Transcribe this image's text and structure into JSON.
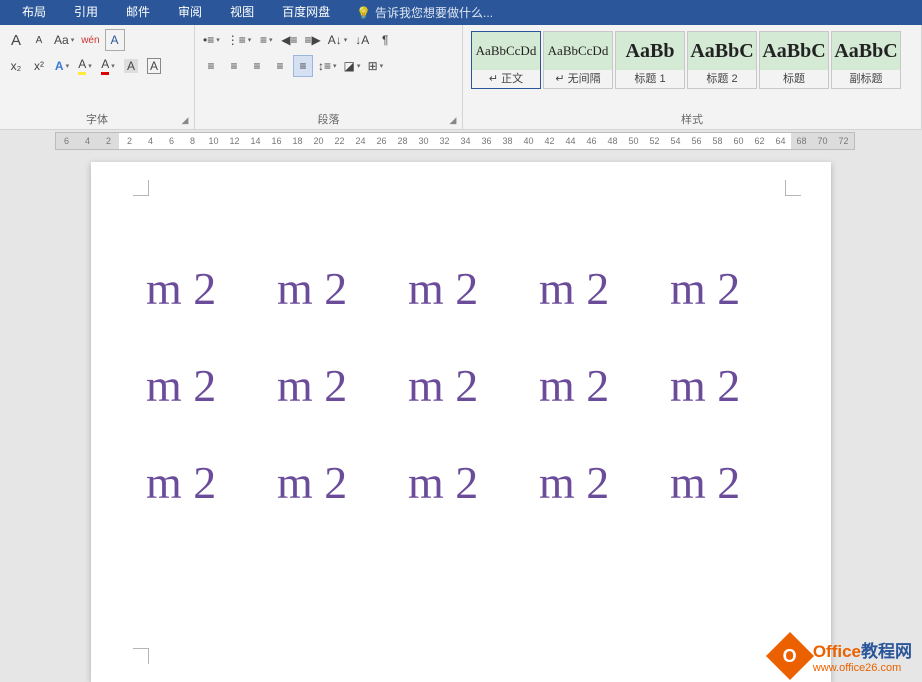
{
  "menubar": {
    "tabs": [
      "布局",
      "引用",
      "邮件",
      "审阅",
      "视图",
      "百度网盘"
    ],
    "tell_me": "告诉我您想要做什么..."
  },
  "ribbon": {
    "font": {
      "label": "字体",
      "grow": "A",
      "shrink": "A",
      "case": "Aa",
      "phonetic": "wén",
      "clear": "A",
      "sub": "x₂",
      "sup": "x²",
      "text_effect": "A",
      "highlight": "A",
      "font_color": "A",
      "char_shading": "A",
      "char_border": "A"
    },
    "para": {
      "label": "段落",
      "numbering": "⋮≡",
      "bullets": "•≡",
      "multilevel": "≡",
      "dec_indent": "◀≡",
      "inc_indent": "≡▶",
      "cnsort": "A↓",
      "sort": "↓A",
      "marks": "¶",
      "align_l": "≡",
      "align_c": "≡",
      "align_r": "≡",
      "align_j": "≡",
      "align_d": "≡",
      "line_sp": "↕≡",
      "shading": "◪",
      "borders": "⊞"
    },
    "styles": {
      "label": "样式",
      "items": [
        {
          "preview": "AaBbCcDd",
          "name": "正文",
          "big": false
        },
        {
          "preview": "AaBbCcDd",
          "name": "无间隔",
          "big": false
        },
        {
          "preview": "AaBb",
          "name": "标题 1",
          "big": true
        },
        {
          "preview": "AaBbC",
          "name": "标题 2",
          "big": true
        },
        {
          "preview": "AaBbC",
          "name": "标题",
          "big": true
        },
        {
          "preview": "AaBbC",
          "name": "副标题",
          "big": true
        }
      ]
    }
  },
  "ruler": {
    "left_margin": [
      "6",
      "4",
      "2"
    ],
    "body": [
      "2",
      "4",
      "6",
      "8",
      "10",
      "12",
      "14",
      "16",
      "18",
      "20",
      "22",
      "24",
      "26",
      "28",
      "30",
      "32",
      "34",
      "36",
      "38",
      "40",
      "42",
      "44",
      "46",
      "48",
      "50",
      "52",
      "54",
      "56",
      "58",
      "60",
      "62",
      "64"
    ],
    "right_margin": [
      "68",
      "70",
      "72"
    ]
  },
  "document": {
    "cells": [
      "m 2",
      "m 2",
      "m 2",
      "m 2",
      "m 2",
      "m 2",
      "m 2",
      "m 2",
      "m 2",
      "m 2",
      "m 2",
      "m 2",
      "m 2",
      "m 2",
      "m 2"
    ]
  },
  "watermark": {
    "brand1": "Office",
    "brand2": "教程网",
    "url": "www.office26.com",
    "logo_letter": "O"
  }
}
